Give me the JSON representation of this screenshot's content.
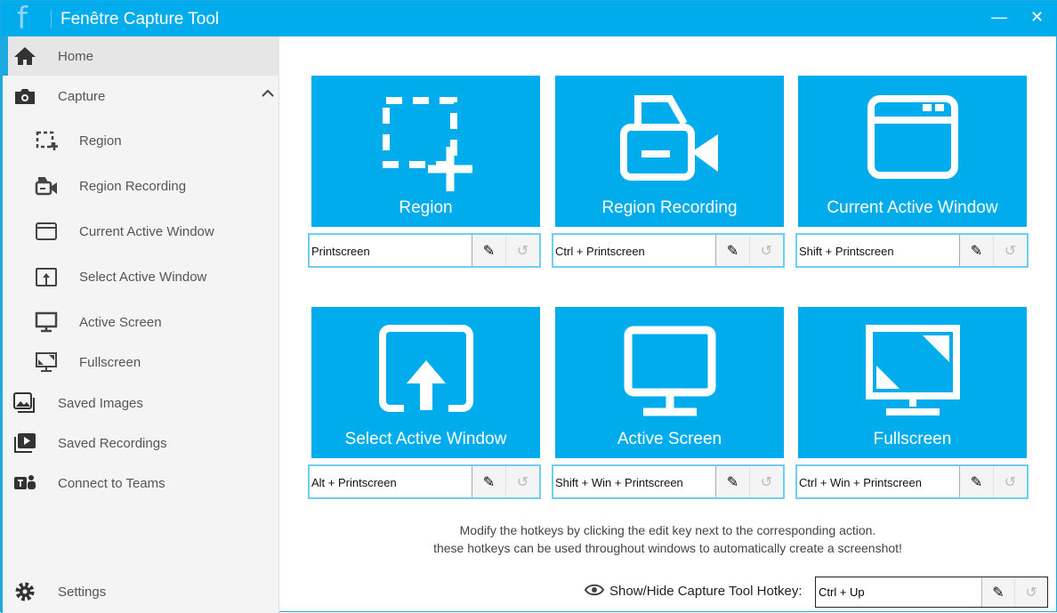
{
  "window": {
    "logo": "f",
    "title": "Fenêtre Capture Tool",
    "min": "—",
    "close": "✕"
  },
  "sidebar": {
    "items": [
      {
        "label": "Home"
      },
      {
        "label": "Capture"
      },
      {
        "label": "Region"
      },
      {
        "label": "Region Recording"
      },
      {
        "label": "Current Active Window"
      },
      {
        "label": "Select Active Window"
      },
      {
        "label": "Active Screen"
      },
      {
        "label": "Fullscreen"
      },
      {
        "label": "Saved Images"
      },
      {
        "label": "Saved Recordings"
      },
      {
        "label": "Connect to Teams"
      },
      {
        "label": "Settings"
      }
    ]
  },
  "tiles": [
    {
      "label": "Region",
      "hotkey": "Printscreen"
    },
    {
      "label": "Region Recording",
      "hotkey": "Ctrl + Printscreen"
    },
    {
      "label": "Current Active Window",
      "hotkey": "Shift + Printscreen"
    },
    {
      "label": "Select Active Window",
      "hotkey": "Alt + Printscreen"
    },
    {
      "label": "Active Screen",
      "hotkey": "Shift + Win + Printscreen"
    },
    {
      "label": "Fullscreen",
      "hotkey": "Ctrl + Win + Printscreen"
    }
  ],
  "note": {
    "line1": "Modify the hotkeys by clicking the edit key next to the corresponding action.",
    "line2": "these hotkeys can be used throughout windows to automatically create a screenshot!"
  },
  "toggle": {
    "label": "Show/Hide Capture Tool Hotkey:",
    "hotkey": "Ctrl + Up"
  },
  "icons": {
    "edit": "✎",
    "reset": "↺"
  }
}
